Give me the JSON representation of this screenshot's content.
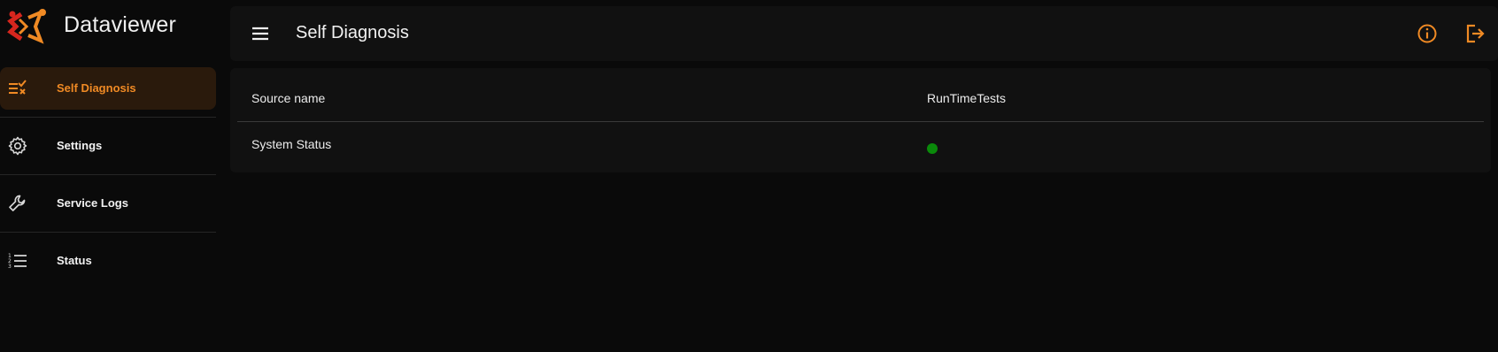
{
  "app": {
    "name": "Dataviewer"
  },
  "colors": {
    "accent": "#f08a24",
    "logo_red": "#d7261e",
    "status_ok": "#0a8a0a"
  },
  "sidebar": {
    "items": [
      {
        "label": "Self Diagnosis",
        "icon": "checklist-icon",
        "active": true
      },
      {
        "label": "Settings",
        "icon": "gear-icon",
        "active": false
      },
      {
        "label": "Service Logs",
        "icon": "wrench-icon",
        "active": false
      },
      {
        "label": "Status",
        "icon": "numbered-list-icon",
        "active": false
      }
    ]
  },
  "header": {
    "title": "Self Diagnosis",
    "menu_icon": "hamburger-menu-icon",
    "info_icon": "info-circle-icon",
    "logout_icon": "logout-icon"
  },
  "table": {
    "columns": [
      "Source name",
      "RunTimeTests"
    ],
    "rows": [
      {
        "source": "System Status",
        "status": "ok"
      }
    ]
  }
}
